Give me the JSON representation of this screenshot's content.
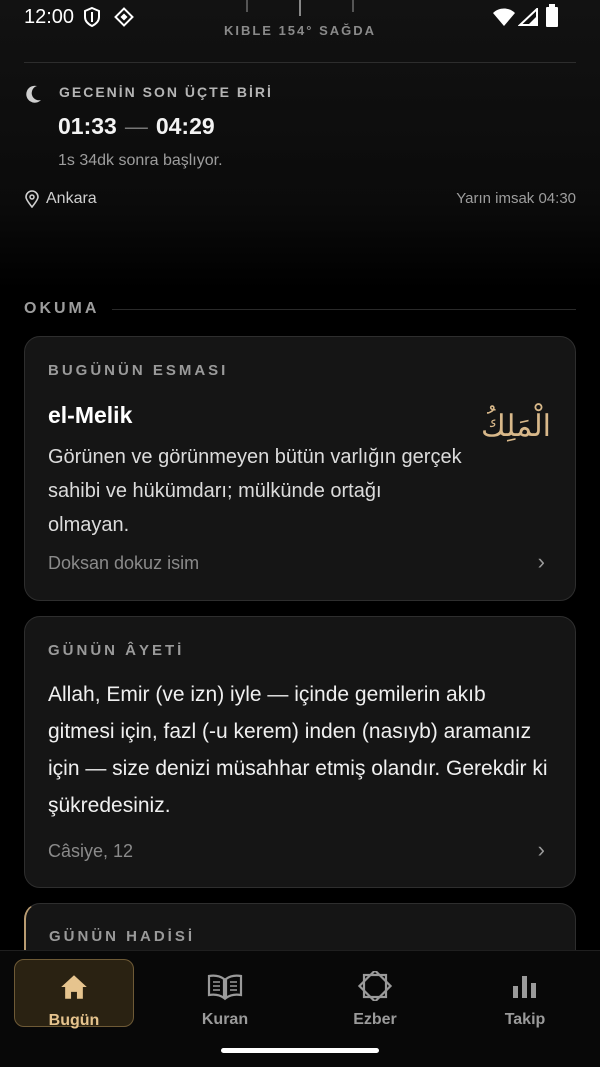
{
  "status": {
    "time": "12:00",
    "icons": [
      "shield-icon",
      "diamond-icon",
      "wifi-icon",
      "cellular-icon",
      "battery-icon"
    ]
  },
  "header": {
    "qibla": "KIBLE 154° SAĞDA"
  },
  "night": {
    "title": "GECENİN SON ÜÇTE BİRİ",
    "start": "01:33",
    "dash": "—",
    "end": "04:29",
    "subtitle": "1s 34dk sonra başlıyor."
  },
  "location": {
    "city": "Ankara",
    "next_imsak": "Yarın imsak 04:30"
  },
  "section": {
    "title": "OKUMA"
  },
  "esma": {
    "label": "BUGÜNÜN ESMASI",
    "name": "el-Melik",
    "arabic": "الْمَلِكُ",
    "description": "Görünen ve görünmeyen bütün varlığın gerçek sahibi ve hükümdarı; mülkünde ortağı olmayan.",
    "link": "Doksan dokuz isim"
  },
  "ayet": {
    "label": "GÜNÜN ÂYETİ",
    "text": "Allah, Emir (ve izn) iyle — içinde gemilerin akıb gitmesi için, fazl (-u kerem) inden (nasıyb) aramanız için — size denizi müsahhar etmiş olandır. Gerekdir ki şükredesiniz.",
    "reference": "Câsiye, 12"
  },
  "hadis": {
    "label": "GÜNÜN HADİSİ"
  },
  "nav": {
    "items": [
      {
        "label": "Bugün",
        "icon": "home-icon",
        "active": true
      },
      {
        "label": "Kuran",
        "icon": "book-icon",
        "active": false
      },
      {
        "label": "Ezber",
        "icon": "star-icon",
        "active": false
      },
      {
        "label": "Takip",
        "icon": "bar-chart-icon",
        "active": false
      }
    ]
  },
  "colors": {
    "accent": "#e6c48e",
    "background": "#000000",
    "card": "#151515"
  }
}
